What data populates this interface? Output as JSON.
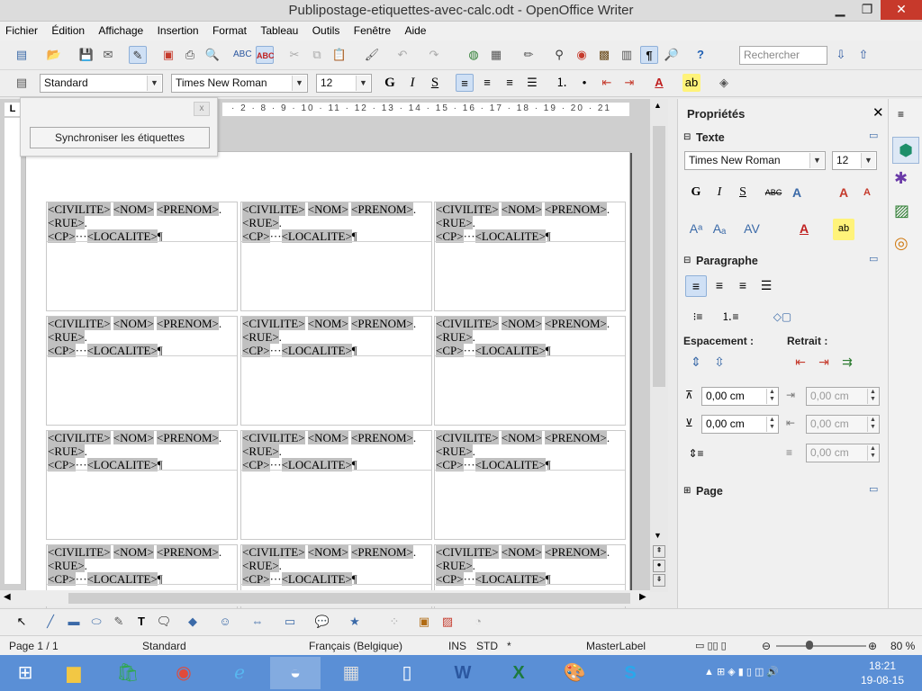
{
  "window": {
    "title": "Publipostage-etiquettes-avec-calc.odt - OpenOffice Writer"
  },
  "menu": [
    "Fichier",
    "Édition",
    "Affichage",
    "Insertion",
    "Format",
    "Tableau",
    "Outils",
    "Fenêtre",
    "Aide"
  ],
  "toolbar": {
    "search_placeholder": "Rechercher",
    "paragraph_style": "Standard",
    "font_name": "Times New Roman",
    "font_size": "12"
  },
  "ruler": {
    "ticks": "· 2 · 8 · 9 · 10 · 11 · 12 · 13 · 14 · 15 · 16 · 17 · 18 · 19 · 20 · 21"
  },
  "popup": {
    "sync_label": "Synchroniser les étiquettes"
  },
  "label": {
    "civilite": "<CIVILITE>",
    "nom": "<NOM>",
    "prenom": "<PRENOM>",
    "rue": "<RUE>",
    "cp": "<CP>",
    "localite": "<LOCALITE>"
  },
  "sidebar": {
    "title": "Propriétés",
    "texte": {
      "title": "Texte",
      "font_name": "Times New Roman",
      "font_size": "12"
    },
    "paragraphe": {
      "title": "Paragraphe",
      "espacement": "Espacement :",
      "retrait": "Retrait :",
      "above": "0,00 cm",
      "below": "0,00 cm",
      "indent_before": "0,00 cm",
      "indent_after": "0,00 cm",
      "first_line": "0,00 cm"
    },
    "page": {
      "title": "Page"
    }
  },
  "status": {
    "page": "Page 1 / 1",
    "style": "Standard",
    "language": "Français (Belgique)",
    "ins": "INS",
    "std": "STD",
    "modified": "*",
    "masterlabel": "MasterLabel",
    "zoom": "80 %"
  },
  "taskbar": {
    "time": "18:21",
    "date": "19-08-15"
  },
  "colors": {
    "accent": "#5a8fd6",
    "field_bg": "#c0c0c0",
    "close_red": "#c7392b"
  }
}
